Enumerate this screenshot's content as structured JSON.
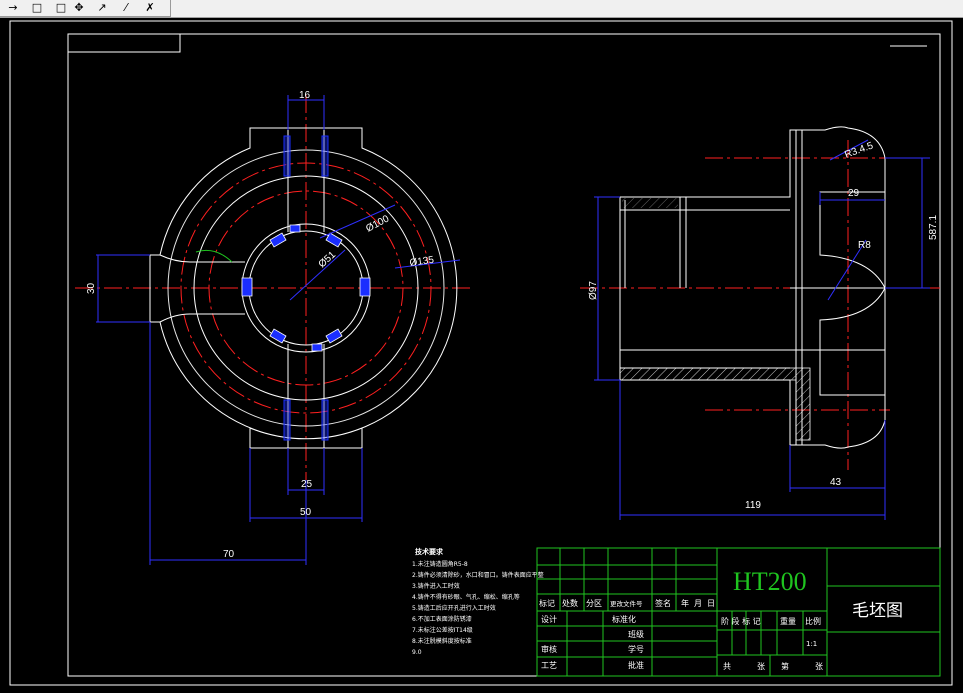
{
  "toolbar": {
    "buttons": [
      {
        "name": "arrow-tool-icon",
        "glyph": "→"
      },
      {
        "name": "rectangle-tool-icon",
        "glyph": "□"
      },
      {
        "name": "rectangle-tool-2-icon",
        "glyph": "□"
      },
      {
        "name": "move-tool-icon",
        "glyph": "✥"
      },
      {
        "name": "pointer-tool-icon",
        "glyph": "↗"
      },
      {
        "name": "measure-tool-icon",
        "glyph": "⁄"
      },
      {
        "name": "erase-tool-icon",
        "glyph": "✗"
      }
    ]
  },
  "colors": {
    "background": "#000000",
    "outline": "#ffffff",
    "centerline": "#ff2020",
    "dimension": "#2f2fff",
    "hatch": "#ffffff",
    "slot_fill": "#1a2eff",
    "title_block": "#1fc41f",
    "title_text": "#ffffff"
  },
  "dimensions": {
    "top_width": "16",
    "inner_dia": "Ø51",
    "mid_dia": "Ø100",
    "outer_dia": "Ø135",
    "lug_height": "30",
    "bottom_slot": "25",
    "bottom_width": "50",
    "overall_70": "70",
    "side_radius": "R3.4.5",
    "side_29": "29",
    "side_height": "587.1",
    "side_r8": "R8",
    "side_dia": "Ø97",
    "side_43": "43",
    "side_length": "119"
  },
  "notes": {
    "title": "技术要求",
    "lines": [
      "1.未注铸造圆角R5-8",
      "2.铸件必须清除砂，水口和冒口。铸件表面应平整",
      "3.铸件进入工时效",
      "4.铸件不得有砂眼、气孔、缩松、缩孔等",
      "5.铸造工后应开孔进行入工时效",
      "6.不加工表面涂防锈漆",
      "7.未标注公差按IT14级",
      "8.未注脱模斜度按标准",
      "9.0"
    ]
  },
  "title_block": {
    "material": "HT200",
    "drawing_name": "毛坯图",
    "row_labels": [
      "标记",
      "处数",
      "分区",
      "更改文件号",
      "签名",
      "年",
      "月",
      "日"
    ],
    "design": "设计",
    "standardize": "标准化",
    "class": "班级",
    "review": "审核",
    "student_id": "学号",
    "process": "工艺",
    "approve": "批准",
    "stage_mark": "阶 段 标 记",
    "weight": "重量",
    "scale_label": "比例",
    "scale_value": "1:1",
    "sheets_total": "共",
    "sheets_unit": "张",
    "sheet_no": "第",
    "sheet_unit": "张"
  }
}
